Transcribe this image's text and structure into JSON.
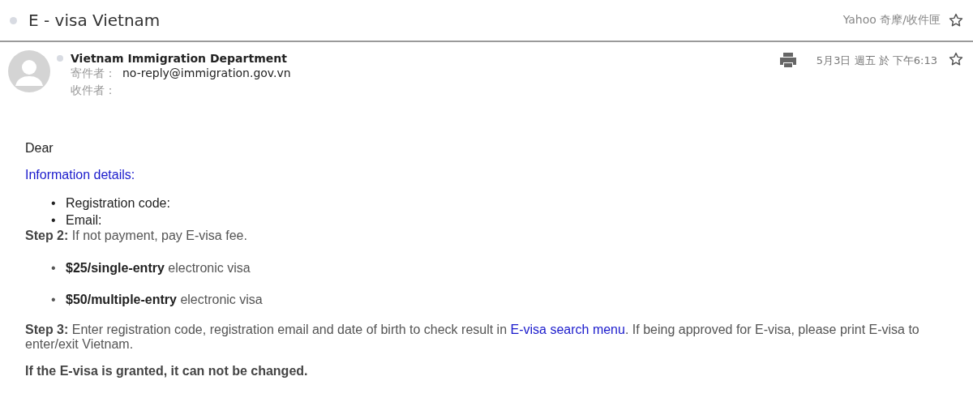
{
  "subject": {
    "title": "E - visa Vietnam",
    "folder": "Yahoo 奇摩/收件匣",
    "starred": false
  },
  "message": {
    "sender": "Vietnam Immigration Department",
    "from_label": "寄件者：",
    "from": "no-reply@immigration.gov.vn",
    "to_label": "收件者：",
    "date": "5月3日 週五 於 下午6:13",
    "starred": false
  },
  "body": {
    "greeting": "Dear",
    "info_heading": "Information details:",
    "info_items": [
      {
        "marker": "•",
        "text": "Registration code:"
      },
      {
        "marker": "•",
        "text": "Email:"
      }
    ],
    "step2": "**Step 2:** If not payment, pay E-visa fee.",
    "fees": [
      {
        "marker": "•",
        "text": "**$25/single-entry** electronic visa"
      },
      {
        "marker": "•",
        "text": "**$50/multiple-entry** electronic visa"
      }
    ],
    "step3": {
      "before": "**Step 3:** Enter registration code, registration email and date of birth to check result in ",
      "link": "E-visa search menu",
      "after": ". If being approved for E-visa, please print E-visa to enter/exit Vietnam."
    },
    "notice": "If the E-visa is granted, it can not be changed."
  }
}
